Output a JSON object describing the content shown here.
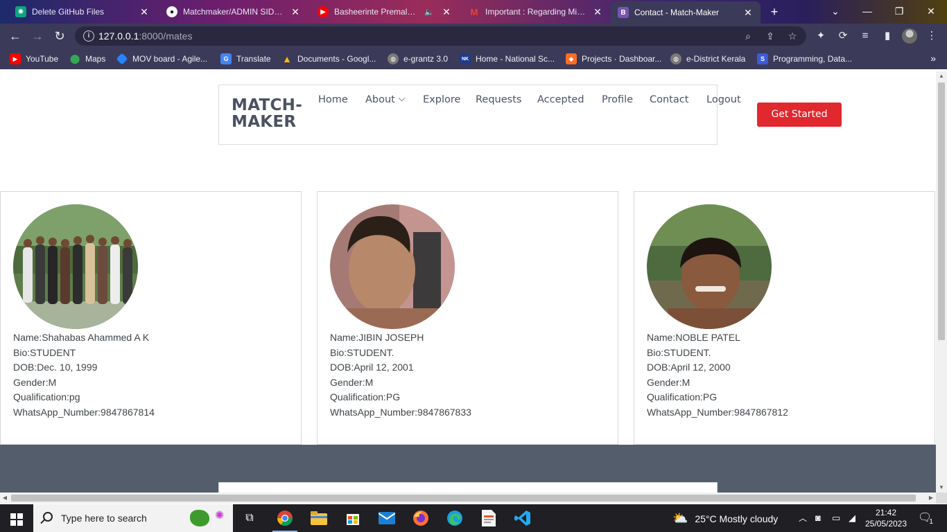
{
  "browser": {
    "tabs": [
      {
        "title": "Delete GitHub Files",
        "icon": "chatgpt-icon",
        "color": "#10a37f"
      },
      {
        "title": "Matchmaker/ADMIN SIDE D",
        "icon": "github-icon",
        "color": "#24292f"
      },
      {
        "title": "Basheerinte Premalekha",
        "icon": "youtube-icon",
        "color": "#ff0000"
      },
      {
        "title": "Important : Regarding Mini-P",
        "icon": "gmail-icon",
        "color": "#d93025"
      },
      {
        "title": "Contact - Match-Maker",
        "icon": "bootstrap-icon",
        "color": "#7952b3"
      }
    ],
    "active_tab": 4,
    "url_host": "127.0.0.1",
    "url_rest": ":8000/mates",
    "bookmarks": [
      {
        "label": "YouTube",
        "icon": "youtube-icon",
        "color": "#ff0000"
      },
      {
        "label": "Maps",
        "icon": "maps-icon",
        "color": "#34a853"
      },
      {
        "label": "MOV board - Agile...",
        "icon": "jira-icon",
        "color": "#2684ff"
      },
      {
        "label": "Translate",
        "icon": "translate-icon",
        "color": "#4285f4"
      },
      {
        "label": "Documents - Googl...",
        "icon": "drive-icon",
        "color": "#fbbc04"
      },
      {
        "label": "e-grantz 3.0",
        "icon": "globe-icon",
        "color": "#7a7a7a"
      },
      {
        "label": "Home - National Sc...",
        "icon": "nsp-icon",
        "color": "#1f3c88"
      },
      {
        "label": "Projects · Dashboar...",
        "icon": "gitlab-icon",
        "color": "#fc6d26"
      },
      {
        "label": "e-District Kerala",
        "icon": "globe-icon",
        "color": "#7a7a7a"
      },
      {
        "label": "Programming, Data...",
        "icon": "s-icon",
        "color": "#3b5bdb"
      }
    ]
  },
  "site": {
    "logo_line1": "MATCH-",
    "logo_line2": "MAKER",
    "nav": [
      "Home",
      "About",
      "Explore",
      "Requests",
      "Accepted",
      "Profile",
      "Contact",
      "Logout"
    ],
    "cta_label": "Get Started",
    "accent_color": "#e0282e"
  },
  "mates": [
    {
      "name": "Name:Shahabas Ahammed A K",
      "bio": "Bio:STUDENT",
      "dob": "DOB:Dec. 10, 1999",
      "gender": "Gender:M",
      "qualification": "Qualification:pg",
      "whatsapp": "WhatsApp_Number:9847867814"
    },
    {
      "name": "Name:JIBIN JOSEPH",
      "bio": "Bio:STUDENT.",
      "dob": "DOB:April 12, 2001",
      "gender": "Gender:M",
      "qualification": "Qualification:PG",
      "whatsapp": "WhatsApp_Number:9847867833"
    },
    {
      "name": "Name:NOBLE PATEL",
      "bio": "Bio:STUDENT.",
      "dob": "DOB:April 12, 2000",
      "gender": "Gender:M",
      "qualification": "Qualification:PG",
      "whatsapp": "WhatsApp_Number:9847867812"
    }
  ],
  "taskbar": {
    "search_placeholder": "Type here to search",
    "weather": "25°C  Mostly cloudy",
    "time": "21:42",
    "date": "25/05/2023",
    "notifications": "1"
  }
}
